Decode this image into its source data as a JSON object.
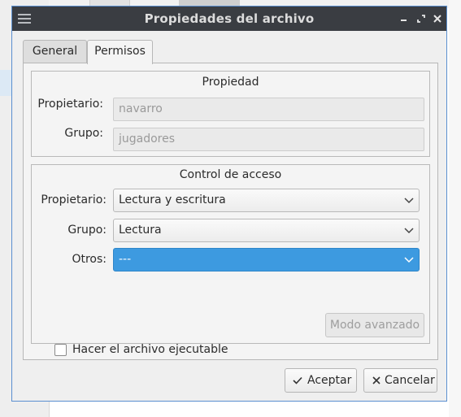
{
  "window": {
    "title": "Propiedades del archivo"
  },
  "tabs": [
    {
      "label": "General",
      "active": false
    },
    {
      "label": "Permisos",
      "active": true
    }
  ],
  "ownership": {
    "title": "Propiedad",
    "owner_label": "Propietario:",
    "owner_value": "navarro",
    "group_label": "Grupo:",
    "group_value": "jugadores"
  },
  "access": {
    "title": "Control de acceso",
    "owner_label": "Propietario:",
    "owner_value": "Lectura y escritura",
    "group_label": "Grupo:",
    "group_value": "Lectura",
    "others_label": "Otros:",
    "others_value": "---",
    "executable_label": "Hacer el archivo ejecutable",
    "executable_checked": false,
    "advanced_label": "Modo avanzado"
  },
  "buttons": {
    "ok_label": "Aceptar",
    "cancel_label": "Cancelar"
  },
  "colors": {
    "titlebar": "#3a3d42",
    "accent": "#3d9ae0",
    "window_border": "#5a8fd0"
  }
}
